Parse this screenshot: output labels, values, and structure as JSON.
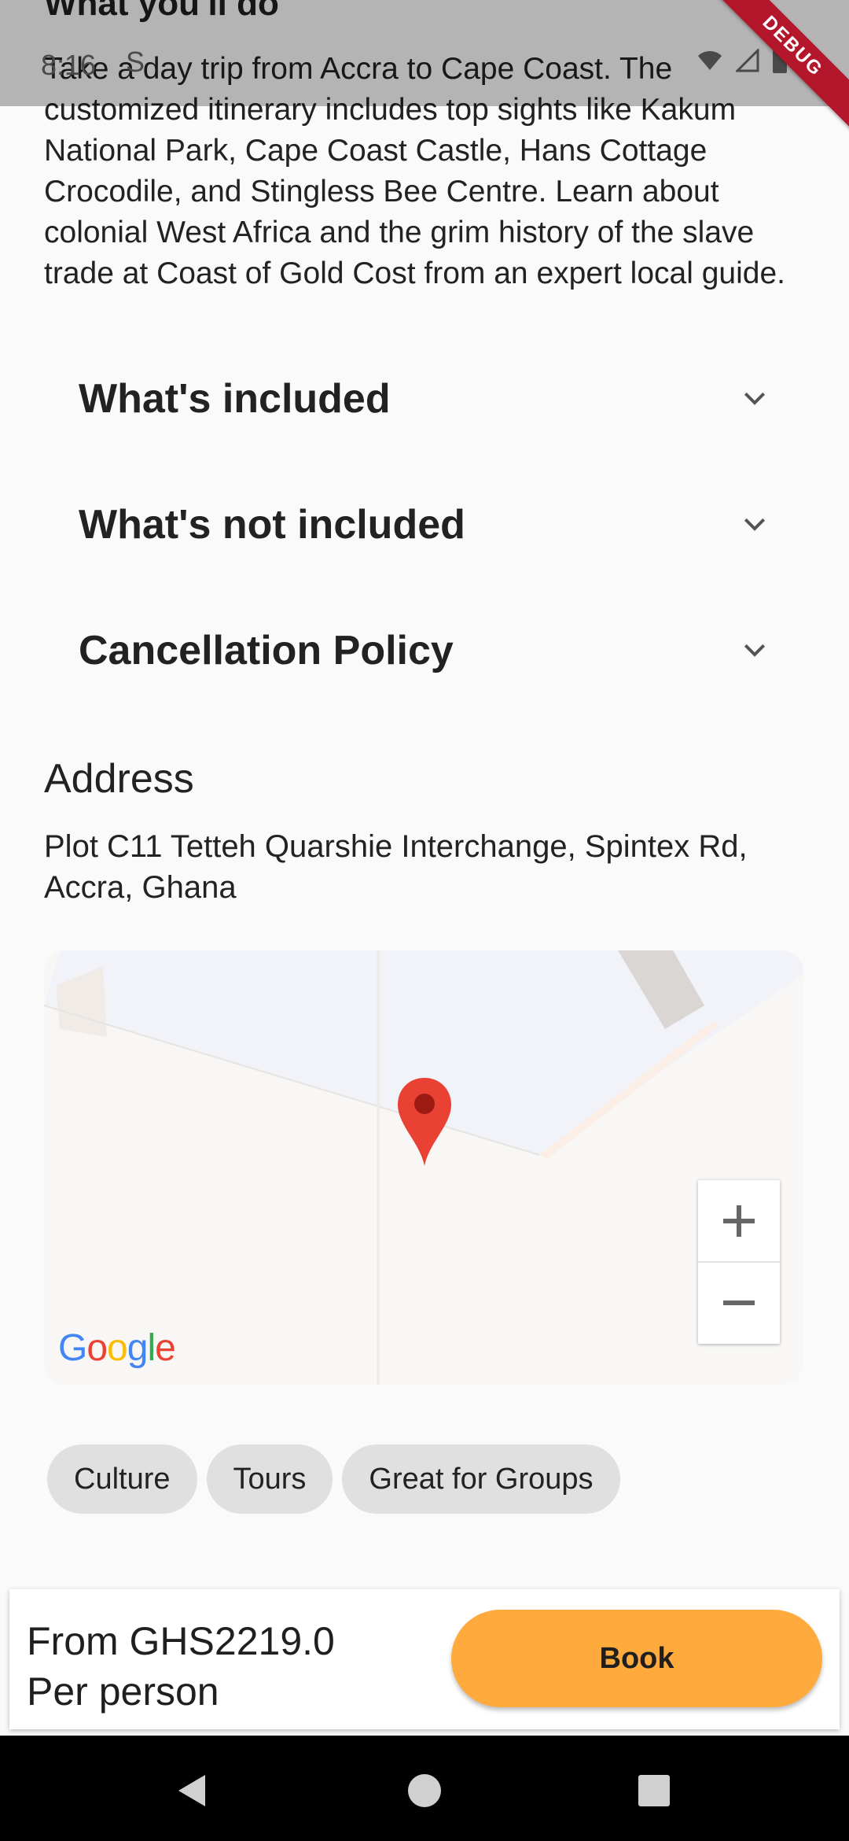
{
  "status_bar": {
    "time": "8:16",
    "s_label": "S"
  },
  "debug_banner": "DEBUG",
  "section": {
    "heading": "What you'll do",
    "description": "Take a day trip from Accra to Cape Coast. The customized itinerary includes top sights like Kakum National Park, Cape Coast Castle,  Hans Cottage Crocodile, and Stingless Bee  Centre. Learn about colonial West Africa and the grim history of the slave trade at Coast of Gold Cost from an expert local guide."
  },
  "expanders": [
    {
      "title": "What's included",
      "icon": "chevron-down-icon"
    },
    {
      "title": "What's not included",
      "icon": "chevron-down-icon"
    },
    {
      "title": "Cancellation Policy",
      "icon": "chevron-down-icon"
    }
  ],
  "address": {
    "heading": "Address",
    "text": "Plot C11 Tetteh Quarshie Interchange, Spintex Rd, Accra, Ghana"
  },
  "map": {
    "logo_letters": [
      "G",
      "o",
      "o",
      "g",
      "l",
      "e"
    ],
    "logo_colors": [
      "#4285F4",
      "#EA4335",
      "#FBBC05",
      "#4285F4",
      "#34A853",
      "#EA4335"
    ],
    "zoom_in": "+",
    "zoom_out": "−",
    "marker_color": "#e94235"
  },
  "tags": [
    "Culture",
    "Tours",
    "Great for Groups"
  ],
  "booking": {
    "price_line1": "From GHS2219.0",
    "price_line2": "Per person",
    "book_label": "Book",
    "accent": "#ffaa3c"
  },
  "nav": {
    "back": "back-icon",
    "home": "home-icon",
    "recents": "recents-icon"
  }
}
